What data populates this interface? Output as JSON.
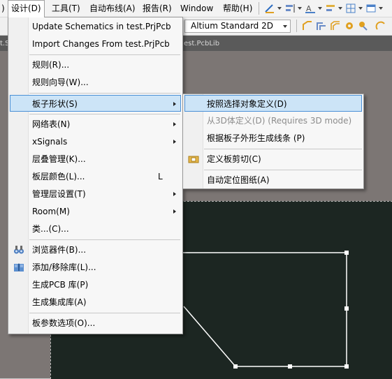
{
  "menubar": {
    "items": [
      {
        "label": ")"
      },
      {
        "label": "设计(D)"
      },
      {
        "label": "工具(T)"
      },
      {
        "label": "自动布线(A)"
      },
      {
        "label": "报告(R)"
      },
      {
        "label": "Window"
      },
      {
        "label": "帮助(H)"
      }
    ]
  },
  "toolbar": {
    "view_mode": "Altium Standard 2D"
  },
  "tabs": {
    "left_fragment": "t.S",
    "pcblib_fragment": "est.PcbLib"
  },
  "design_menu": {
    "items": [
      {
        "label": "Update Schematics in test.PrjPcb"
      },
      {
        "label": "Import Changes From test.PrjPcb"
      },
      {
        "label": "规则(R)..."
      },
      {
        "label": "规则向导(W)..."
      },
      {
        "label": "板子形状(S)"
      },
      {
        "label": "网络表(N)"
      },
      {
        "label": "xSignals"
      },
      {
        "label": "层叠管理(K)..."
      },
      {
        "label": "板层颜色(L)...",
        "shortcut": "L"
      },
      {
        "label": "管理层设置(T)"
      },
      {
        "label": "Room(M)"
      },
      {
        "label": "类...(C)..."
      },
      {
        "label": "浏览器件(B)..."
      },
      {
        "label": "添加/移除库(L)..."
      },
      {
        "label": "生成PCB 库(P)"
      },
      {
        "label": "生成集成库(A)"
      },
      {
        "label": "板参数选项(O)..."
      }
    ]
  },
  "board_shape_menu": {
    "items": [
      {
        "label": "按照选择对象定义(D)"
      },
      {
        "label": "从3D体定义(D) (Requires 3D mode)"
      },
      {
        "label": "根据板子外形生成线条 (P)"
      },
      {
        "label": "定义板剪切(C)"
      },
      {
        "label": "自动定位图纸(A)"
      }
    ]
  },
  "colors": {
    "highlight": "#cce4f7",
    "highlight_border": "#4a90d6",
    "board": "#1c2622",
    "workspace": "#7c7674"
  }
}
